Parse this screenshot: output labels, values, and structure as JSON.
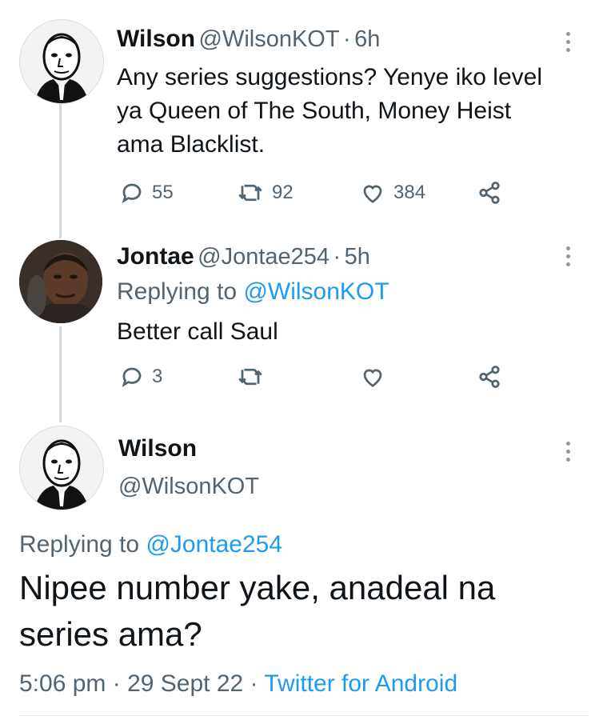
{
  "tweets": [
    {
      "name": "Wilson",
      "handle": "@WilsonKOT",
      "time": "6h",
      "text_lines": [
        "Any series suggestions? Yenye iko level",
        "ya Queen of The South, Money Heist",
        "ama Blacklist."
      ],
      "replies": "55",
      "retweets": "92",
      "likes": "384"
    },
    {
      "name": "Jontae",
      "handle": "@Jontae254",
      "time": "5h",
      "replying_prefix": "Replying to",
      "replying_to": "@WilsonKOT",
      "text": "Better call Saul",
      "replies": "3"
    }
  ],
  "main_tweet": {
    "name": "Wilson",
    "handle": "@WilsonKOT",
    "replying_prefix": "Replying to",
    "replying_to": "@Jontae254",
    "text_lines": [
      "Nipee number yake, anadeal na",
      "series ama?"
    ],
    "time": "5:06 pm",
    "date": "29 Sept 22",
    "source": "Twitter for Android"
  },
  "separator": "·",
  "icons": {
    "reply": "reply-icon",
    "retweet": "retweet-icon",
    "like": "heart-icon",
    "share": "share-icon",
    "more": "more-options-icon"
  },
  "colors": {
    "link": "#1d9bf0",
    "muted": "#536471",
    "thread_line": "#cfd9de"
  }
}
